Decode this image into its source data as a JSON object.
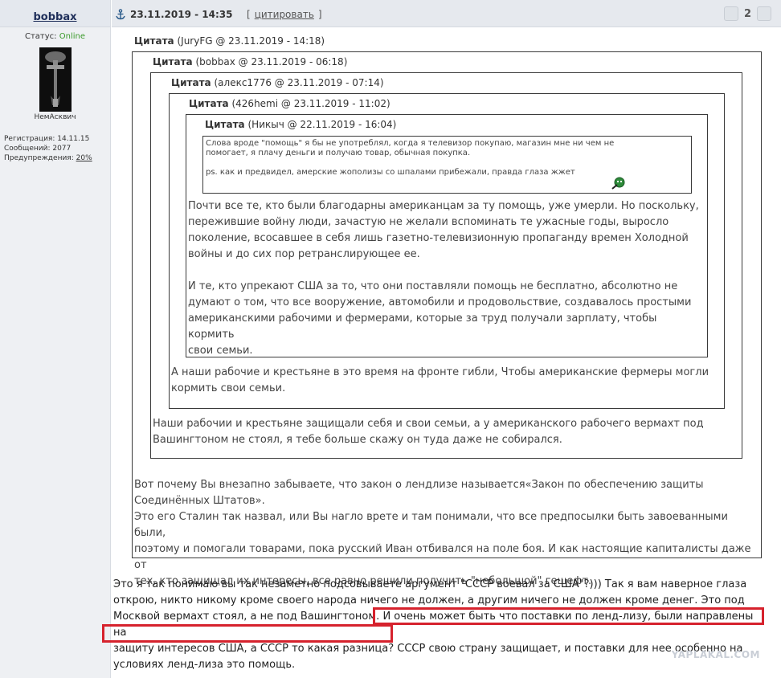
{
  "user": {
    "name": "bobbax",
    "status_label": "Статус:",
    "status_value": "Online",
    "avatar_name": "НемАсквич",
    "registration": "Регистрация: 14.11.15",
    "messages": "Сообщений: 2077",
    "warnings_label": "Предупреждения:",
    "warnings_value": "20%"
  },
  "post": {
    "date": "23.11.2019 - 14:35",
    "quote_link": "цитировать",
    "bracket_open": "[",
    "bracket_close": "]",
    "rating": "2"
  },
  "quotes": [
    {
      "label": "Цитата",
      "meta": "(JuryFG @ 23.11.2019 - 14:18)"
    },
    {
      "label": "Цитата",
      "meta": "(bobbax @ 23.11.2019 - 06:18)"
    },
    {
      "label": "Цитата",
      "meta": "(алекс1776 @ 23.11.2019 - 07:14)"
    },
    {
      "label": "Цитата",
      "meta": "(426hemi @ 23.11.2019 - 11:02)"
    },
    {
      "label": "Цитата",
      "meta": "(Никыч @ 22.11.2019 - 16:04)"
    }
  ],
  "q5": {
    "l1": "Слова вроде \"помощь\" я бы не употреблял, когда я телевизор покупаю, магазин мне ни чем не",
    "l2": "помогает, я плачу деньги и получаю товар, обычная покупка.",
    "l3": "ps. как и предвидел, амерские жополизы со шпалами прибежали, правда глаза жжет"
  },
  "q4": {
    "l1": "Почти все те, кто были благодарны американцам за ту помощь, уже умерли. Но поскольку,",
    "l2": "пережившие войну люди, зачастую не желали вспоминать те ужасные годы, выросло",
    "l3": "поколение, всосавшее в себя лишь газетно-телевизионную пропаганду времен Холодной",
    "l4": "войны и до сих пор ретранслирующее ее.",
    "l5": "И те, кто упрекают США за то, что они поставляли помощь не бесплатно, абсолютно не",
    "l6": "думают о том, что все вооружение, автомобили и продовольствие, создавалось простыми",
    "l7": "американскими рабочими и фермерами, которые за труд получали зарплату, чтобы кормить",
    "l8": "свои семьи."
  },
  "q3": {
    "l1": "А наши рабочие и крестьяне в это время на фронте гибли, Чтобы американские фермеры могли",
    "l2": "кормить свои семьи."
  },
  "q2": {
    "l1": "Наши рабочии и крестьяне защищали себя и свои семьи, а у американского рабочего вермахт под",
    "l2": "Вашингтоном не стоял, я тебе больше скажу он туда даже не собирался."
  },
  "q1": {
    "l1": "Вот почему Вы внезапно забываете, что закон о лендлизе называется«Закон по обеспечению защиты",
    "l2": "Соединённых Штатов».",
    "l3": "Это его Сталин так назвал, или Вы нагло врете и там понимали, что все предпосылки быть завоеванными были,",
    "l4": "поэтому и помогали товарами, пока русский Иван отбивался на поле боя. И как настоящие капиталисты даже от",
    "l5": "тех, кто защищал их интересы, все равно решили получить \"небольшой\" гешефт."
  },
  "main": {
    "l1": "Это я так понимаю вы так незаметно подсовываете аргумент \"СССР воевал за США\"?))) Так я вам наверное глаза",
    "l2": "открою, никто никому кроме своего народа ничего не должен, а другим ничего не должен кроме денег. Это под",
    "l3a": "Москвой вермахт стоял, а не под Вашингтоном.",
    "l3b": "И очень может быть что поставки по ленд-лизу, были направлены на",
    "l4a": "защиту интересов США, а СССР то какая разница?",
    "l4b": "СССР свою страну защищает, и поставки для нее особенно на",
    "l5": "условиях ленд-лиза это помощь."
  },
  "watermark": "YAPLAKAL.COM",
  "colors": {
    "accent": "#1f2f5a",
    "online": "#3a9a2a",
    "highlight": "#d6222d"
  }
}
